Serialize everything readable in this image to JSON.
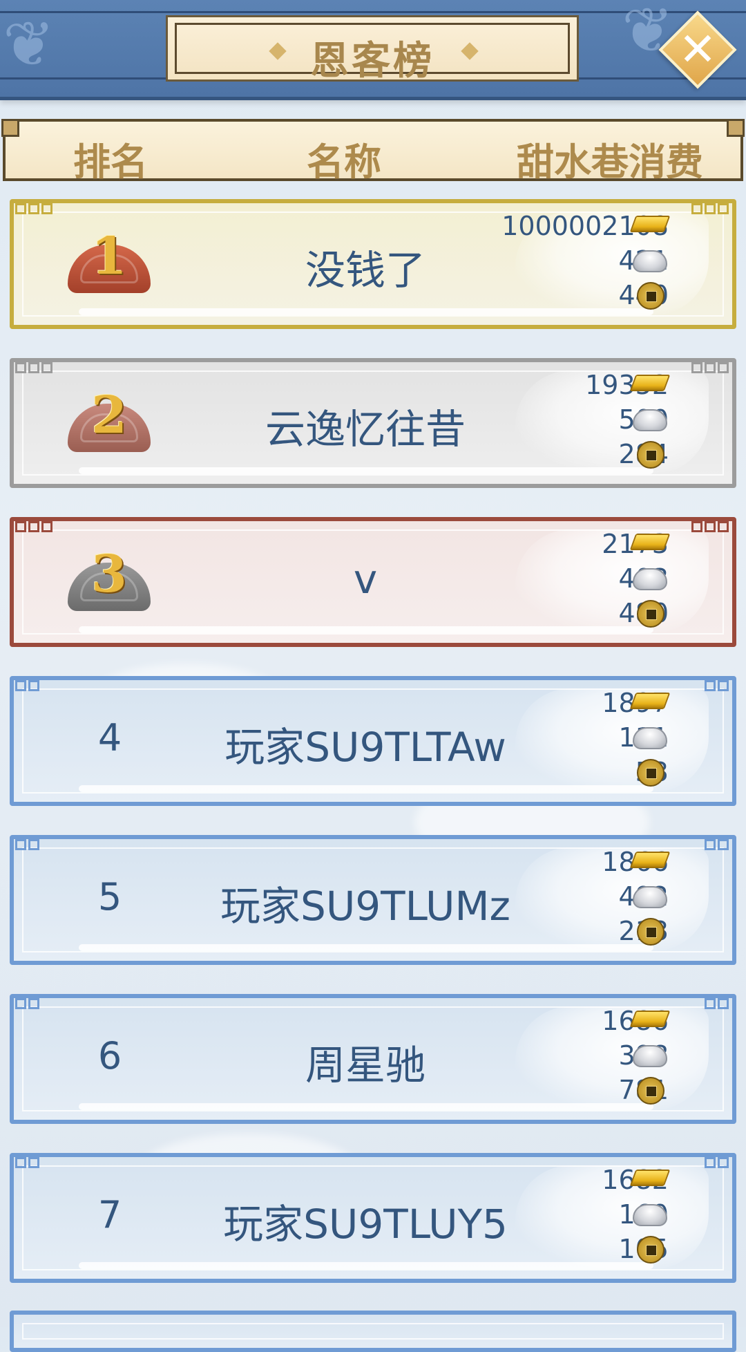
{
  "header": {
    "title": "恩客榜",
    "close_label": "✕"
  },
  "columns": {
    "rank": "排名",
    "name": "名称",
    "consumption": "甜水巷消费"
  },
  "rows": [
    {
      "rank": "1",
      "name": "没钱了",
      "gold": "1000002108",
      "silver": "421",
      "coin": "440"
    },
    {
      "rank": "2",
      "name": "云逸忆往昔",
      "gold": "19352",
      "silver": "500",
      "coin": "284"
    },
    {
      "rank": "3",
      "name": "v",
      "gold": "2173",
      "silver": "403",
      "coin": "480"
    },
    {
      "rank": "4",
      "name": "玩家SU9TLTAw",
      "gold": "1897",
      "silver": "111",
      "coin": "53"
    },
    {
      "rank": "5",
      "name": "玩家SU9TLUMz",
      "gold": "1866",
      "silver": "492",
      "coin": "213"
    },
    {
      "rank": "6",
      "name": "周星驰",
      "gold": "1686",
      "silver": "398",
      "coin": "781"
    },
    {
      "rank": "7",
      "name": "玩家SU9TLUY5",
      "gold": "1682",
      "silver": "169",
      "coin": "105"
    }
  ],
  "icons": {
    "gold": "gold-ingot-icon",
    "silver": "silver-ingot-icon",
    "coin": "copper-coin-icon",
    "close": "close-icon"
  },
  "colors": {
    "topbar": "#5c83b4",
    "title_text": "#a8874d",
    "text": "#34567e",
    "gold_frame": "#c6ad3e",
    "silver_frame": "#9c9c9c",
    "bronze_frame": "#9b4a3c",
    "blue_frame": "#6f9bd4"
  }
}
